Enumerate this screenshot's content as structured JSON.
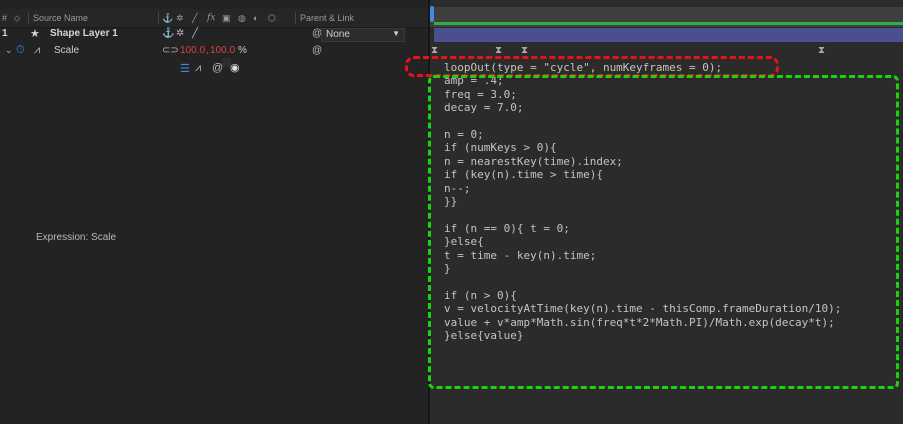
{
  "header": {
    "hash": "#",
    "source_col": "Source Name",
    "switch_icons": [
      "anchor-icon",
      "sun-icon",
      "pen-icon",
      "fx-icon",
      "film-icon",
      "circle-icon",
      "cube-icon"
    ],
    "parent_col": "Parent & Link"
  },
  "layer": {
    "number": "1",
    "name": "Shape Layer 1",
    "parent_value": "None"
  },
  "property": {
    "name": "Scale",
    "value_x": "100.0",
    "value_sep": ",",
    "value_y": "100.0",
    "unit": "%"
  },
  "expression_label": "Expression: Scale",
  "code_lines": [
    "loopOut(type = \"cycle\", numKeyframes = 0);",
    "amp = .4;",
    "freq = 3.0;",
    "decay = 7.0;",
    "",
    "n = 0;",
    "if (numKeys > 0){",
    "n = nearestKey(time).index;",
    "if (key(n).time > time){",
    "n--;",
    "}}",
    "",
    "if (n == 0){ t = 0;",
    "}else{",
    "t = time - key(n).time;",
    "}",
    "",
    "if (n > 0){",
    "v = velocityAtTime(key(n).time - thisComp.frameDuration/10);",
    "value + v*amp*Math.sin(freq*t*2*Math.PI)/Math.exp(decay*t);",
    "}else{value}"
  ],
  "colors": {
    "value_red": "#e0413a",
    "layer_bar": "#4a4f8f",
    "playhead": "#3b8de0",
    "highlight_red": "#e8101a",
    "highlight_green": "#17d40f"
  }
}
